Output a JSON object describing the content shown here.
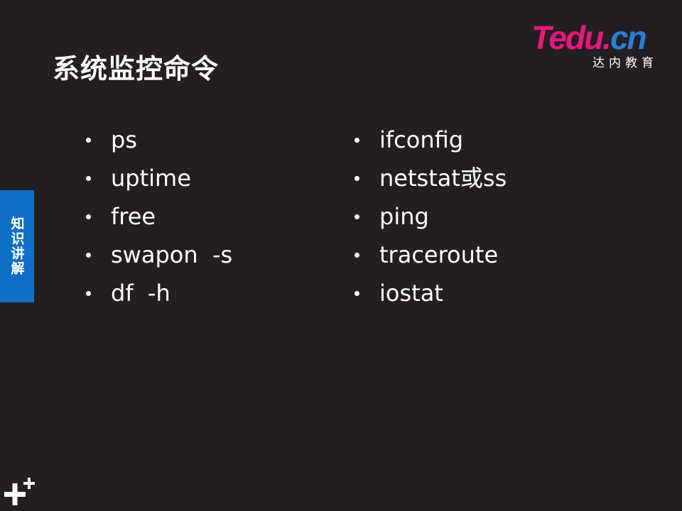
{
  "title": "系统监控命令",
  "logo": {
    "brand": "Tedu",
    "dot": ".",
    "tld": "cn",
    "subtitle": "达内教育",
    "colors": {
      "brand": "#e8177d",
      "tld": "#2a7fd4"
    }
  },
  "side_tab": {
    "label": "知识讲解",
    "color": "#0f6fc6"
  },
  "left_items": [
    "ps",
    "uptime",
    "free",
    "swapon  -s",
    "df  -h"
  ],
  "right_items": [
    "ifconfig",
    "netstat或ss",
    "ping",
    "traceroute",
    "iostat"
  ],
  "icons": {
    "corner": "plus-icon"
  },
  "colors": {
    "background": "#231f20",
    "text": "#ffffff"
  }
}
